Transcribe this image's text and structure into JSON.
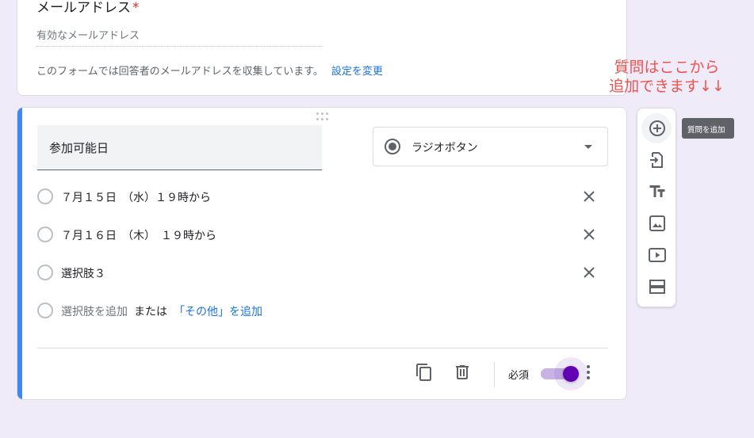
{
  "email_section": {
    "title": "メールアドレス",
    "required_mark": "*",
    "placeholder": "有効なメールアドレス",
    "note": "このフォームでは回答者のメールアドレスを収集しています。",
    "change_link": "設定を変更"
  },
  "question": {
    "title": "参加可能日",
    "type_label": "ラジオボタン",
    "options": [
      {
        "label": "７月１５日　（水）１９時から"
      },
      {
        "label": "７月１６日　（木）　１９時から"
      },
      {
        "label": "選択肢３"
      }
    ],
    "add_option": {
      "label": "選択肢を追加",
      "or_text": "または",
      "other_link": "「その他」を追加"
    },
    "required_label": "必須",
    "required_on": true
  },
  "sidebar": {
    "tooltip": "質問を追加",
    "items": [
      "add-question-icon",
      "import-questions-icon",
      "add-title-icon",
      "add-image-icon",
      "add-video-icon",
      "add-section-icon"
    ]
  },
  "annotation": {
    "line1": "質問はここから",
    "line2": "追加できます↓↓"
  },
  "colors": {
    "background": "#f0ebf8",
    "accent_blue": "#4285f4",
    "toggle_purple": "#6200b3",
    "annotation_red": "#ef5350",
    "link": "#1a73e8"
  }
}
